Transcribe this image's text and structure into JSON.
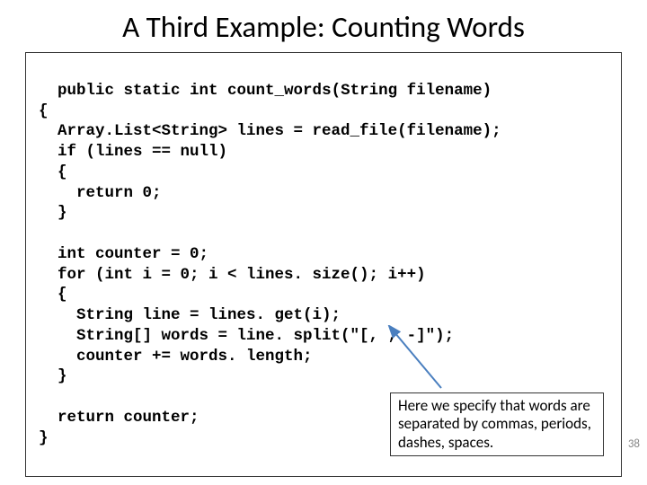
{
  "title": "A Third Example: Counting Words",
  "code": "public static int count_words(String filename)\n{\n  Array.List<String> lines = read_file(filename);\n  if (lines == null)\n  {\n    return 0;\n  }\n\n  int counter = 0;\n  for (int i = 0; i < lines. size(); i++)\n  {\n    String line = lines. get(i);\n    String[] words = line. split(\"[, , -]\");\n    counter += words. length;\n  }\n\n  return counter;\n}",
  "callout": "Here we specify that words are separated by commas, periods, dashes, spaces.",
  "page_number": "38"
}
